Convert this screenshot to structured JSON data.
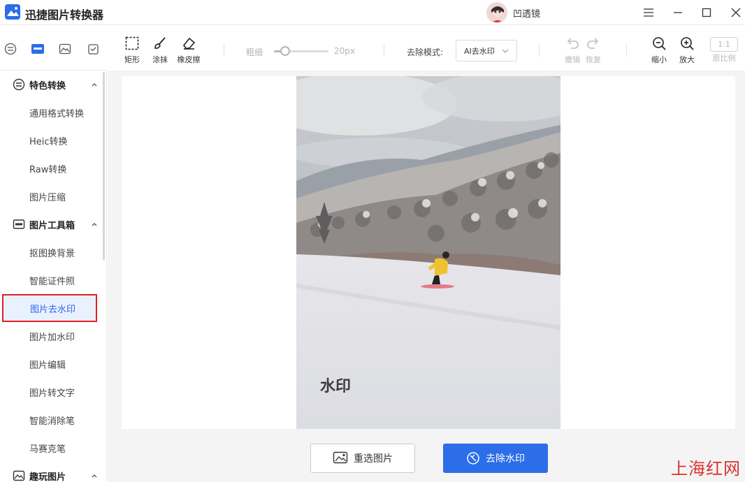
{
  "app": {
    "title": "迅捷图片转换器"
  },
  "user": {
    "name": "凹透镜"
  },
  "sidebar": {
    "sections": [
      {
        "label": "特色转换",
        "items": [
          "通用格式转换",
          "Heic转换",
          "Raw转换",
          "图片压缩"
        ]
      },
      {
        "label": "图片工具箱",
        "items": [
          "抠图换背景",
          "智能证件照",
          "图片去水印",
          "图片加水印",
          "图片编辑",
          "图片转文字",
          "智能消除笔",
          "马赛克笔"
        ]
      },
      {
        "label": "趣玩图片",
        "items": []
      }
    ],
    "active_item": "图片去水印"
  },
  "toolbar": {
    "rect_label": "矩形",
    "smear_label": "涂抹",
    "eraser_label": "橡皮擦",
    "thickness_label": "粗细",
    "thickness_value": "20px",
    "thickness_fraction": 0.2,
    "mode_label": "去除模式:",
    "mode_value": "AI去水印",
    "undo_label": "撤销",
    "redo_label": "恢复",
    "zoom_out_label": "缩小",
    "zoom_in_label": "放大",
    "ratio_box": "1:1",
    "original_label": "原比例"
  },
  "canvas": {
    "watermark_text": "水印"
  },
  "actions": {
    "reselect_label": "重选图片",
    "remove_label": "去除水印"
  },
  "overlay": {
    "site_mark": "上海红网"
  },
  "colors": {
    "accent": "#2c6de8",
    "highlight_border": "#e02020",
    "active_bg": "#eaf1fe"
  }
}
